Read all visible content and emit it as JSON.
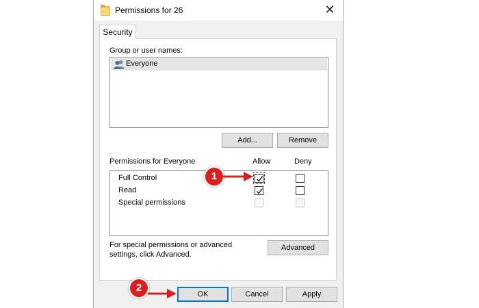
{
  "window": {
    "title": "Permissions for 26",
    "close_glyph": "✕"
  },
  "tabs": [
    {
      "label": "Security"
    }
  ],
  "group_section": {
    "label": "Group or user names:",
    "items": [
      {
        "label": "Everyone",
        "icon": "users-icon",
        "selected": true
      }
    ],
    "add_label": "Add...",
    "remove_label": "Remove"
  },
  "permissions_section": {
    "label": "Permissions for Everyone",
    "allow_header": "Allow",
    "deny_header": "Deny",
    "rows": [
      {
        "name": "Full Control",
        "allow": true,
        "deny": false,
        "disabled": false
      },
      {
        "name": "Read",
        "allow": true,
        "deny": false,
        "disabled": false
      },
      {
        "name": "Special permissions",
        "allow": false,
        "deny": false,
        "disabled": true
      }
    ]
  },
  "advanced_section": {
    "note": "For special permissions or advanced settings, click Advanced.",
    "advanced_label": "Advanced"
  },
  "footer": {
    "ok_label": "OK",
    "cancel_label": "Cancel",
    "apply_label": "Apply"
  },
  "annotations": {
    "step1": "1",
    "step2": "2",
    "color": "#d92020"
  }
}
